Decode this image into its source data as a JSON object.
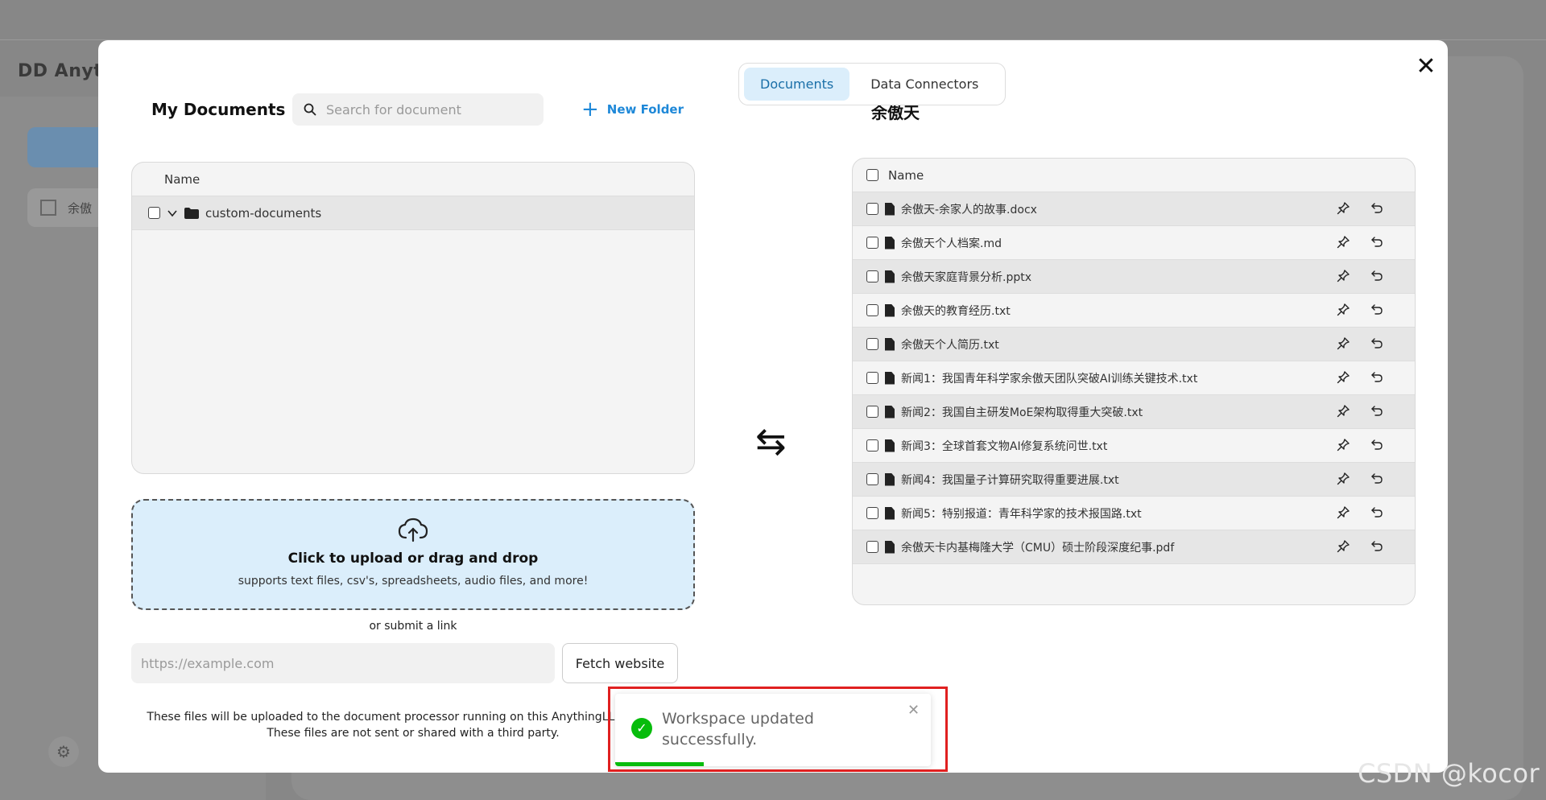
{
  "background": {
    "logo": "DD Anyth",
    "workspace_label": "余傲"
  },
  "tabs": [
    {
      "label": "Documents"
    },
    {
      "label": "Data Connectors"
    }
  ],
  "my_documents": {
    "title": "My Documents",
    "search_placeholder": "Search for document",
    "new_folder_label": "New Folder",
    "column_name": "Name",
    "folders": [
      {
        "name": "custom-documents"
      }
    ]
  },
  "upload": {
    "title": "Click to upload or drag and drop",
    "subtitle": "supports text files, csv's, spreadsheets, audio files, and more!",
    "or_link": "or submit a link",
    "url_placeholder": "https://example.com",
    "fetch_label": "Fetch website",
    "disclaimer_line1": "These files will be uploaded to the document processor running on this AnythingLLM instance.",
    "disclaimer_line2": "These files are not sent or shared with a third party."
  },
  "workspace": {
    "title": "余傲天",
    "column_name": "Name",
    "files": [
      "余傲天-余家人的故事.docx",
      "余傲天个人档案.md",
      "余傲天家庭背景分析.pptx",
      "余傲天的教育经历.txt",
      "余傲天个人简历.txt",
      "新闻1：我国青年科学家余傲天团队突破AI训练关键技术.txt",
      "新闻2：我国自主研发MoE架构取得重大突破.txt",
      "新闻3：全球首套文物AI修复系统问世.txt",
      "新闻4：我国量子计算研究取得重要进展.txt",
      "新闻5：特别报道：青年科学家的技术报国路.txt",
      "余傲天卡内基梅隆大学（CMU）硕士阶段深度纪事.pdf"
    ]
  },
  "toast": {
    "message": "Workspace updated successfully.",
    "progress": 0.28
  },
  "watermark": "CSDN @kocor",
  "colors": {
    "accent": "#1e88d8",
    "active_tab_bg": "#dbeefb",
    "success": "#07bc0c",
    "highlight": "#e02020"
  }
}
